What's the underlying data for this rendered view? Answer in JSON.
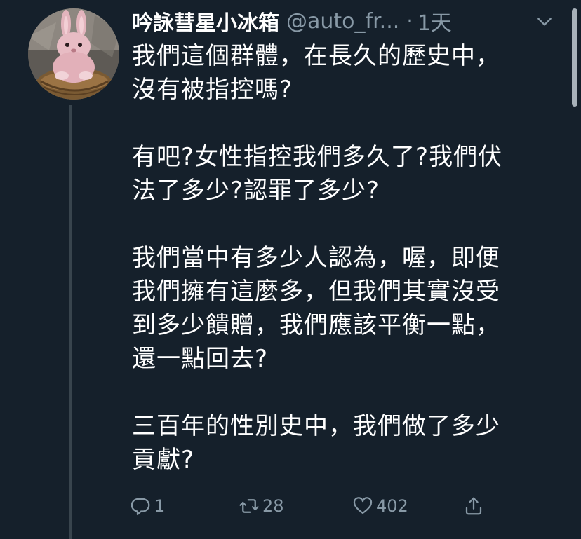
{
  "colors": {
    "background": "#15202b",
    "text_primary": "#ffffff",
    "text_secondary": "#8899a6",
    "thread_line": "#38444d"
  },
  "tweet": {
    "display_name": "吟詠彗星小冰箱",
    "handle": "@auto_fr...",
    "separator": "·",
    "time": "1天",
    "paragraphs": [
      [
        "我們這個群體，在長久的歷史中，",
        "沒有被指控嗎?"
      ],
      [
        "有吧?女性指控我們多久了?我們伏",
        "法了多少?認罪了多少?"
      ],
      [
        "我們當中有多少人認為，喔，即便",
        "我們擁有這麼多，但我們其實沒受",
        "到多少饋贈，我們應該平衡一點，",
        "還一點回去?"
      ],
      [
        "三百年的性別史中，我們做了多少",
        "貢獻?"
      ]
    ],
    "actions": {
      "reply_count": "1",
      "retweet_count": "28",
      "like_count": "402"
    },
    "icons": {
      "avatar": "plush-bunny-avatar",
      "menu": "chevron-down-icon",
      "reply": "reply-icon",
      "retweet": "retweet-icon",
      "like": "heart-icon",
      "share": "share-icon"
    }
  }
}
